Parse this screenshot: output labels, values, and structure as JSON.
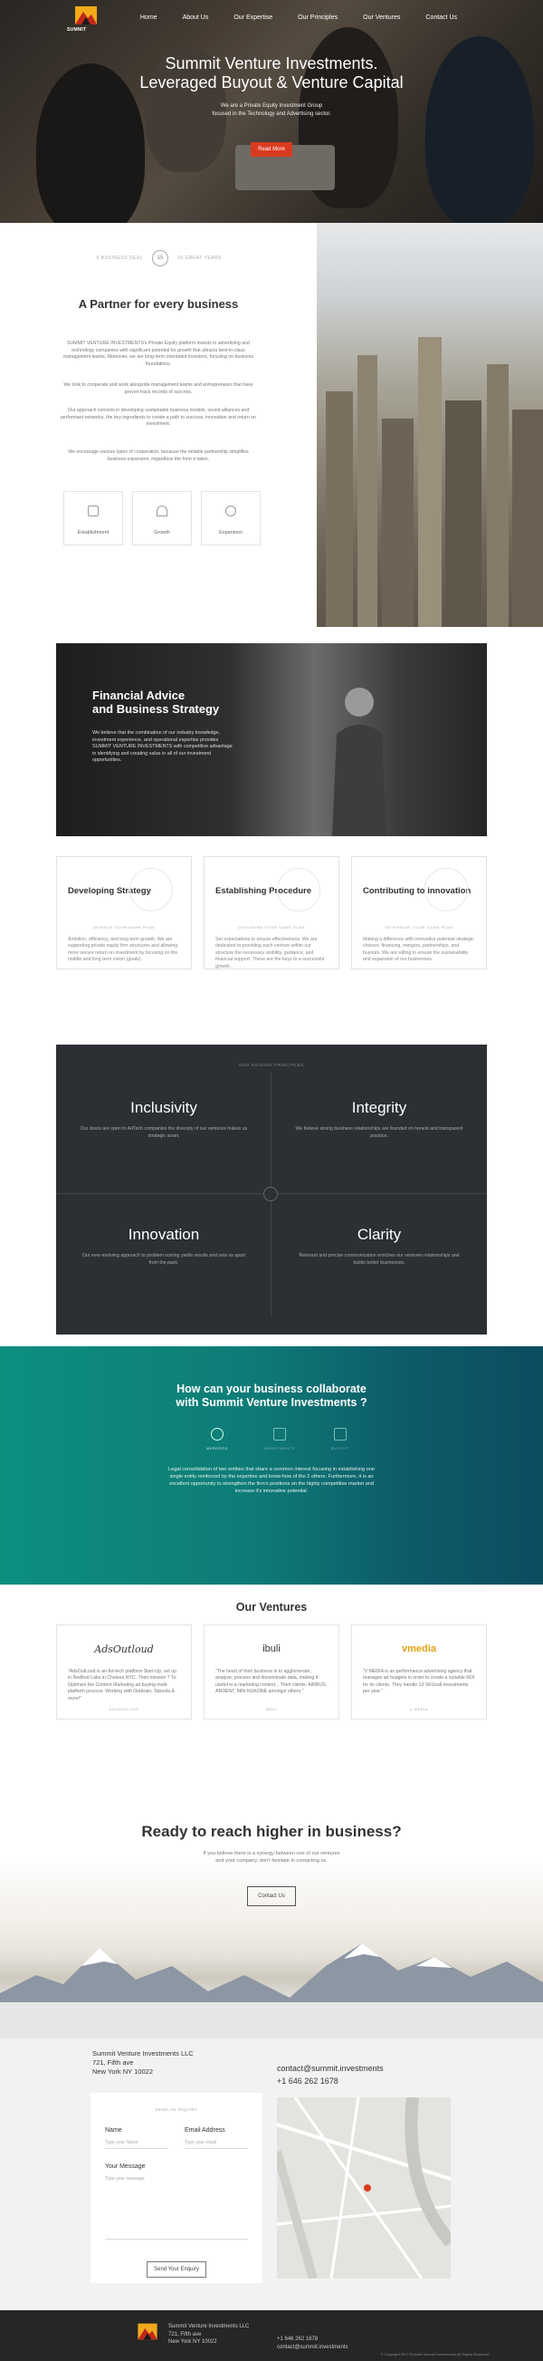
{
  "brand": {
    "name": "SUMMIT"
  },
  "nav": [
    "Home",
    "About Us",
    "Our Expertise",
    "Our Principles",
    "Our Ventures",
    "Contact Us"
  ],
  "hero": {
    "title_line1": "Summit Venture Investments.",
    "title_line2": "Leveraged Buyout & Venture Capital",
    "sub_line1": "We are a Private Equity Investment Group",
    "sub_line2": "focused in the Technology and Advertising sector.",
    "button": "Read More"
  },
  "partner": {
    "stat_left": "5 BUSINESS DEAL",
    "stat_center": "15",
    "stat_right": "15 GREAT YEARS",
    "title": "A Partner for every business",
    "paragraphs": [
      "SUMMIT VENTURE INVESTMENTS's Private Equity platform invests in advertising and technology companies with significant potential for growth that attracts best-in-class management teams. Moreover, we are long-term orientated investors, focusing on business foundations.",
      "We look to cooperate and work alongside management teams and entrepreneurs that have proven track records of success.",
      "Our approach consists in developing sustainable business models, sound alliances and performant networks, the key ingredients to create a path to success, innovation and return on investment.",
      "We encourage various types of cooperation, because the reliable partnership simplifies business expansion, regardless the form it takes."
    ],
    "features": [
      "Establishment",
      "Growth",
      "Expansion"
    ]
  },
  "financial": {
    "title_line1": "Financial Advice",
    "title_line2": "and Business Strategy",
    "text": "We believe that the combination of our industry knowledge, investment experience, and operational expertise provides SUMMIT VENTURE INVESTMENTS with competitive advantage in identifying and creating value in all of our investment opportunities."
  },
  "strategy_cards": [
    {
      "title": "Developing Strategy",
      "tag": "ACHIEVE YOUR GAME PLAN",
      "text": "Ambition, efficiency, and long term growth. We are supporting private equity firm structures and allowing more secure return on investment by focusing on the middle and long term vision (goals)."
    },
    {
      "title": "Establishing Procedure",
      "tag": "DESIGNING YOUR GAME PLAN",
      "text": "Set expectations to ensure effectiveness. We are dedicated to providing each venture within our structure the necessary visibility, guidance, and financial support. These are the keys to a successful growth."
    },
    {
      "title": "Contributing to innovation",
      "tag": "DETERMINE YOUR GAME PLAN",
      "text": "Making a difference with innovative potential strategic choices: financing, mergers, partnerships, and buyouts. We are willing to ensure the sustainability and expansion of our businesses."
    }
  ],
  "principles": {
    "label": "OUR GUIDING PRINCIPLES",
    "items": [
      {
        "title": "Inclusivity",
        "text": "Our doors are open to AdTech companies the diversity of our ventures makes us strategic asset."
      },
      {
        "title": "Integrity",
        "text": "We believe strong business relationships are founded on honest and transparent practice."
      },
      {
        "title": "Innovation",
        "text": "Our ever-evolving approach to problem solving yields results and sets us apart from the pack."
      },
      {
        "title": "Clarity",
        "text": "Relevant and precise communication enriches our ventures relationships and builds better businesses."
      }
    ]
  },
  "collaborate": {
    "title_line1": "How can your business collaborate",
    "title_line2": "with Summit Venture Investments ?",
    "icons": [
      "MERGERS",
      "INVESTMENTS",
      "BUYOUT"
    ],
    "text": "Legal consolidation of two entities that share a common interest focusing in establishing one single entity reinforced by the expertise and know-how of the 2 others. Furthermore, it is an excellent opportunity to strengthen the firm's positions on the highly competitive market and increase it's innovative potential."
  },
  "ventures": {
    "title": "Our Ventures",
    "items": [
      {
        "logo": "AdsOutloud",
        "text": "“AdsOutLoud is an Ad-tech platform Start-Up, set up in Redfoot Labs in Chelsea NYC. Their mission ? To Optimize the Content Marketing ad buying multi-platform process. Working with Outbrain, Taboola & more!”",
        "name": "ADSOUTLOUD"
      },
      {
        "logo": "ibuli",
        "text": "“The heart of their business is to agglomerate, analyze, process and disseminate data, making it useful in a marketing context... Their clients: AIRBUS, ARDENT, MIN-NUKONE amongst others.”",
        "name": "IBULI"
      },
      {
        "logo": "vmedia",
        "text": "“V MEDIA is an performance advertising agency that manages ad budgets in order to create a suitable ROI for its clients. They handle 13 SKUcell investments per year.”",
        "name": "V MEDIA"
      }
    ]
  },
  "ready": {
    "title": "Ready to reach higher in business?",
    "text_line1": "If you believe there is a synergy between one of our ventures",
    "text_line2": "and your company, don't hesitate in contacting us.",
    "button": "Contact Us"
  },
  "contact": {
    "company": "Summit Venture Investments LLC",
    "street": "721, Fifth ave",
    "city": "New York NY 10022",
    "email": "contact@summit.investments",
    "phone": "+1 646 262 1678",
    "form_label": "SEND AN INQUIRY",
    "name_label": "Name",
    "name_placeholder": "Type your Name",
    "email_label": "Email Address",
    "email_placeholder": "Type your email",
    "message_label": "Your Message",
    "message_placeholder": "Type your message",
    "submit": "Send Your Enquiry"
  },
  "footer": {
    "company": "Summit Venture Investments LLC",
    "street": "721, Fifth ave",
    "city": "New York NY 10022",
    "phone": "+1 646 262 1678",
    "email": "contact@summit.investments",
    "copyright": "© Copyright 2017 Summit Venture Investments All Rights Reserved"
  },
  "colors": {
    "accent": "#d93b1f",
    "teal": "#0e7c77",
    "dark": "#2c2f33",
    "footer": "#262626"
  }
}
